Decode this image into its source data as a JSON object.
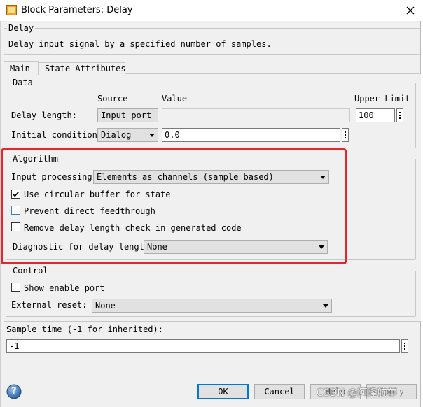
{
  "window": {
    "title": "Block Parameters: Delay",
    "close_glyph": "✕"
  },
  "header": {
    "group_title": "Delay",
    "description": "Delay input signal by a specified number of samples."
  },
  "tabs": [
    {
      "label": "Main",
      "active": true
    },
    {
      "label": "State Attributes",
      "active": false
    }
  ],
  "data_group": {
    "title": "Data",
    "col_source": "Source",
    "col_value": "Value",
    "col_upper_limit": "Upper Limit",
    "rows": [
      {
        "label": "Delay length:",
        "source": "Input port",
        "value": "",
        "upper_limit": "100"
      },
      {
        "label": "Initial condition:",
        "source": "Dialog",
        "value": "0.0"
      }
    ]
  },
  "algorithm_group": {
    "title": "Algorithm",
    "input_processing_label": "Input processing:",
    "input_processing_value": "Elements as channels (sample based)",
    "checkboxes": [
      {
        "label": "Use circular buffer for state",
        "checked": true
      },
      {
        "label": "Prevent direct feedthrough",
        "checked": false
      },
      {
        "label": "Remove delay length check in generated code",
        "checked": false
      }
    ],
    "diagnostic_label": "Diagnostic for delay length:",
    "diagnostic_value": "None",
    "highlight_color": "#e8252a"
  },
  "control_group": {
    "title": "Control",
    "show_enable_port_label": "Show enable port",
    "show_enable_port_checked": false,
    "external_reset_label": "External reset:",
    "external_reset_value": "None"
  },
  "sample_time": {
    "label": "Sample time (-1 for inherited):",
    "value": "-1"
  },
  "buttons": {
    "help_icon": "?",
    "ok": "OK",
    "cancel": "Cancel",
    "help": "Help",
    "apply": "Apply"
  },
  "watermark": "CSDN @阿隆航车",
  "colors": {
    "accent_blue": "#0078d7",
    "highlight_red": "#e8252a",
    "dialog_bg": "#f0f0f0"
  }
}
